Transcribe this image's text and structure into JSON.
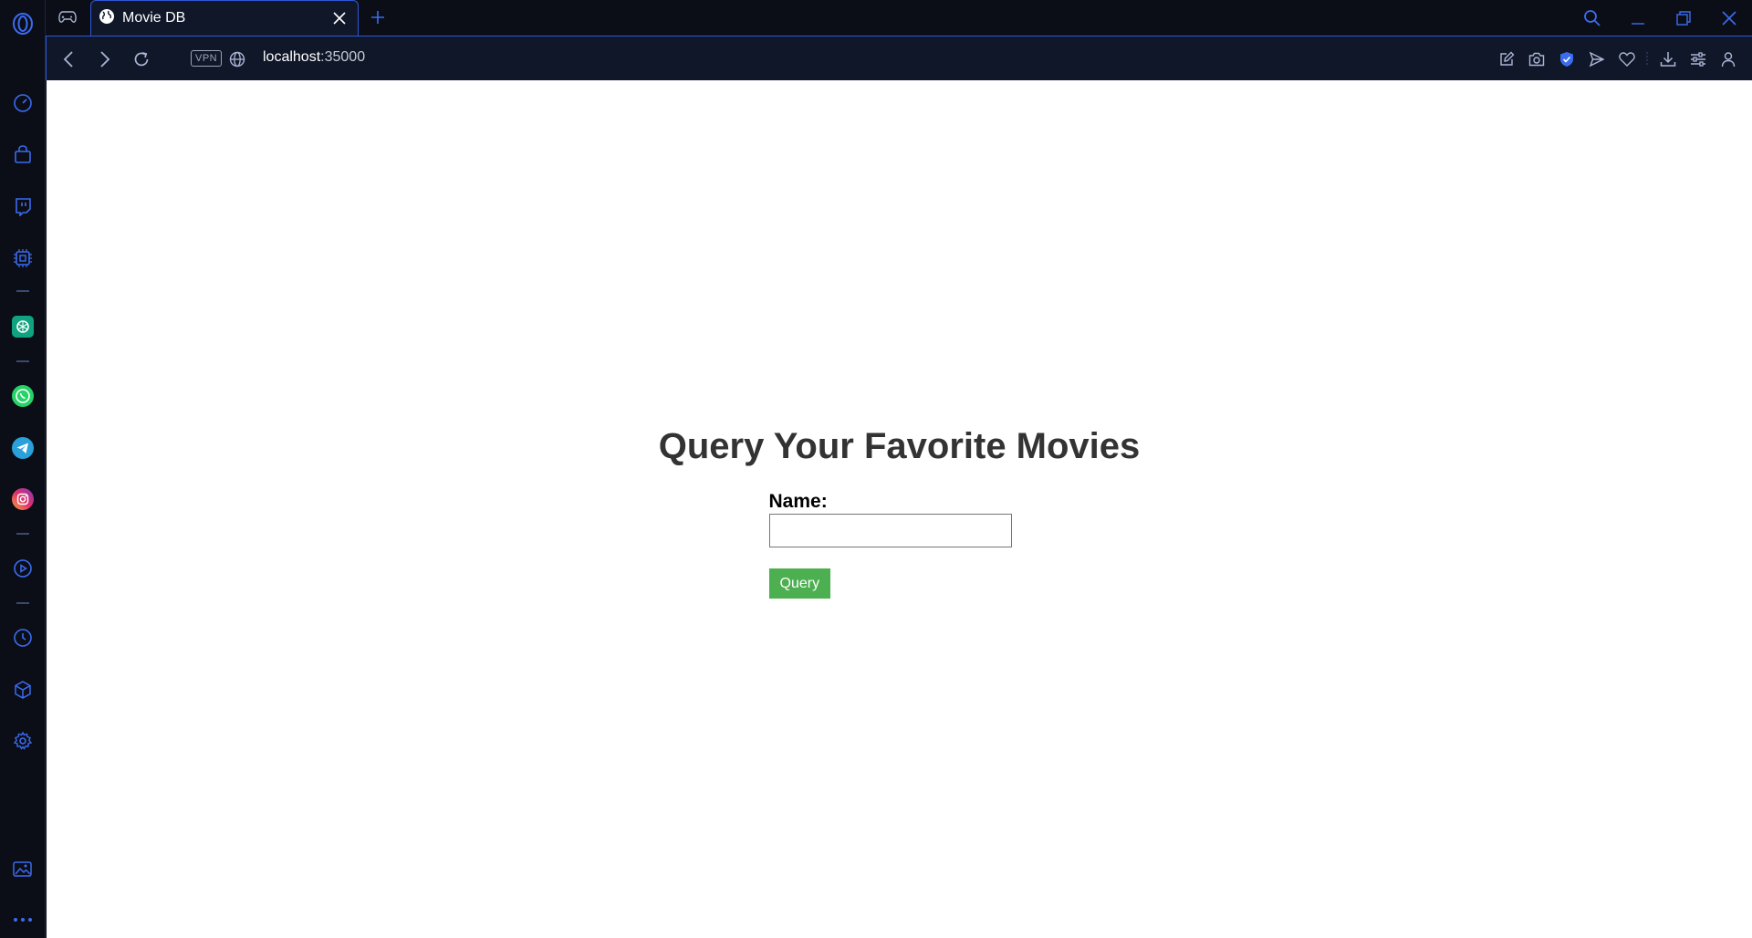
{
  "browser": {
    "tabs": [
      {
        "title": "Movie DB",
        "active": true
      }
    ],
    "address": {
      "host": "localhost",
      "port": ":35000",
      "vpn_label": "VPN"
    },
    "accent_color": "#2f57d6"
  },
  "sidebar": {
    "items": [
      {
        "icon": "speed-dial-icon"
      },
      {
        "icon": "shopping-bag-icon"
      },
      {
        "icon": "twitch-icon"
      },
      {
        "icon": "ai-chip-icon"
      },
      {
        "icon": "chatgpt-icon"
      },
      {
        "icon": "whatsapp-icon"
      },
      {
        "icon": "telegram-icon"
      },
      {
        "icon": "instagram-icon"
      },
      {
        "icon": "player-icon"
      },
      {
        "icon": "history-icon"
      },
      {
        "icon": "box-icon"
      },
      {
        "icon": "settings-gear-icon"
      },
      {
        "icon": "gallery-icon"
      },
      {
        "icon": "more-dots-icon"
      }
    ]
  },
  "page": {
    "heading": "Query Your Favorite Movies",
    "name_label": "Name:",
    "name_value": "",
    "query_button": "Query",
    "button_color": "#4caf50"
  }
}
